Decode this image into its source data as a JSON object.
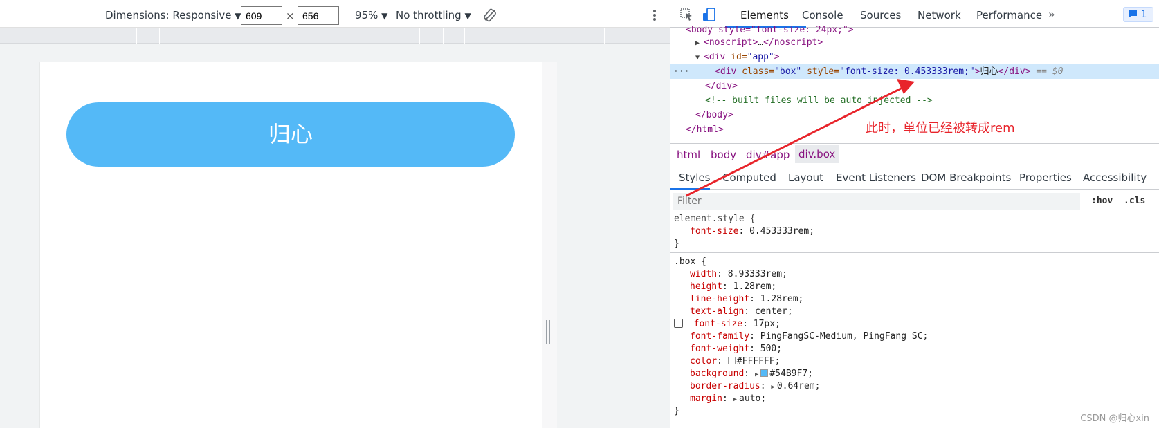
{
  "device_toolbar": {
    "dimensions_label": "Dimensions: Responsive",
    "width_value": "609",
    "times": "×",
    "height_value": "656",
    "zoom": "95%",
    "throttle": "No throttling"
  },
  "page": {
    "box_text": "归心",
    "box_color": "#54B9F7"
  },
  "devtools_tabs": [
    "Elements",
    "Console",
    "Sources",
    "Network",
    "Performance"
  ],
  "more_tabs": "»",
  "issue_badge": "1",
  "dom_lines": {
    "l0": "<body style=\"font-size: 24px;\">",
    "noscript_open": "<noscript>",
    "noscript_ellipsis": "…",
    "noscript_close": "</noscript>",
    "div_app_open": "<div",
    "div_app_attr": " id=",
    "div_app_val": "\"app\"",
    "div_app_end": ">",
    "sel_dots": "···",
    "sel_open": "<div",
    "sel_attr1": " class=",
    "sel_val1": "\"box\"",
    "sel_attr2": " style=",
    "sel_val2": "\"font-size: 0.453333rem;\"",
    "sel_gt": ">",
    "sel_text": "归心",
    "sel_close": "</div>",
    "sel_dollar": " == $0",
    "div_close": "</div>",
    "comment": "<!-- built files will be auto injected -->",
    "body_close": "</body>",
    "html_close": "</html>"
  },
  "annotation": "此时，单位已经被转成rem",
  "breadcrumbs": [
    "html",
    "body",
    "div#app",
    "div.box"
  ],
  "styles_tabs": [
    "Styles",
    "Computed",
    "Layout",
    "Event Listeners",
    "DOM Breakpoints",
    "Properties",
    "Accessibility"
  ],
  "filter": {
    "placeholder": "Filter",
    "hov": ":hov",
    "cls": ".cls"
  },
  "element_style": {
    "selector": "element.style {",
    "prop": "font-size",
    "value": "0.453333rem;",
    "close": "}"
  },
  "box_rule": {
    "selector": ".box {",
    "props": [
      {
        "name": "width",
        "value": "8.93333rem;"
      },
      {
        "name": "height",
        "value": "1.28rem;"
      },
      {
        "name": "line-height",
        "value": "1.28rem;"
      },
      {
        "name": "text-align",
        "value": "center;"
      },
      {
        "name": "font-size",
        "value": "17px;"
      },
      {
        "name": "font-family",
        "value": "PingFangSC-Medium, PingFang SC;"
      },
      {
        "name": "font-weight",
        "value": "500;"
      },
      {
        "name": "color",
        "value": "#FFFFFF;"
      },
      {
        "name": "background",
        "value": "#54B9F7;"
      },
      {
        "name": "border-radius",
        "value": "0.64rem;"
      },
      {
        "name": "margin",
        "value": "auto;"
      }
    ],
    "close": "}"
  },
  "watermark": "CSDN @归心xin"
}
